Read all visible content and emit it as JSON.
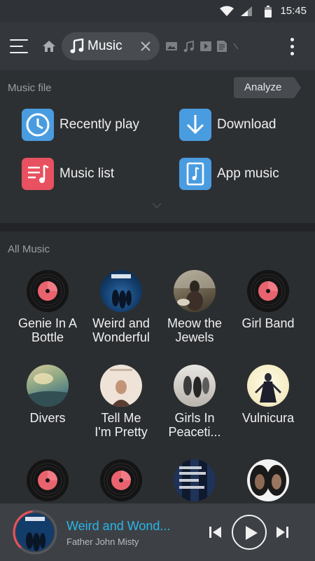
{
  "status_bar": {
    "time": "15:45",
    "icons": [
      "wifi-icon",
      "signal-icon",
      "battery-icon"
    ]
  },
  "top_bar": {
    "menu_icon": "hamburger-menu-icon",
    "home_icon": "home-icon",
    "tab": {
      "icon": "music-note-icon",
      "label": "Music",
      "close_icon": "close-icon"
    },
    "type_icons": [
      "image-icon",
      "music-note-icon",
      "video-icon",
      "document-icon"
    ],
    "more_icon": "more-vertical-icon"
  },
  "music_file": {
    "title": "Music file",
    "analyze_label": "Analyze",
    "categories": [
      {
        "label": "Recently play",
        "icon": "clock-icon",
        "color": "#4a9ce0"
      },
      {
        "label": "Download",
        "icon": "download-icon",
        "color": "#4a9ce0"
      },
      {
        "label": "Music list",
        "icon": "playlist-icon",
        "color": "#e8515f"
      },
      {
        "label": "App music",
        "icon": "music-file-icon",
        "color": "#4a9ce0"
      }
    ]
  },
  "all_music": {
    "title": "All Music",
    "albums": [
      {
        "title_line1": "Genie In A",
        "title_line2": "Bottle",
        "cover": "vinyl-placeholder"
      },
      {
        "title_line1": "Weird and",
        "title_line2": "Wonderful",
        "cover": "album-art"
      },
      {
        "title_line1": "Meow the",
        "title_line2": "Jewels",
        "cover": "album-art"
      },
      {
        "title_line1": "Girl Band",
        "title_line2": "",
        "cover": "vinyl-placeholder"
      },
      {
        "title_line1": "Divers",
        "title_line2": "",
        "cover": "album-art"
      },
      {
        "title_line1": "Tell Me",
        "title_line2": "I'm Pretty",
        "cover": "album-art"
      },
      {
        "title_line1": "Girls In",
        "title_line2": "Peaceti...",
        "cover": "album-art"
      },
      {
        "title_line1": "Vulnicura",
        "title_line2": "",
        "cover": "album-art"
      },
      {
        "title_line1": "",
        "title_line2": "",
        "cover": "vinyl-placeholder"
      },
      {
        "title_line1": "",
        "title_line2": "",
        "cover": "vinyl-placeholder"
      },
      {
        "title_line1": "",
        "title_line2": "",
        "cover": "album-art"
      },
      {
        "title_line1": "",
        "title_line2": "",
        "cover": "album-art"
      }
    ]
  },
  "player": {
    "song": "Weird and Wond...",
    "artist": "Father John Misty",
    "progress": 0.35,
    "accent": "#29b6e8",
    "progress_color": "#e8515f"
  }
}
